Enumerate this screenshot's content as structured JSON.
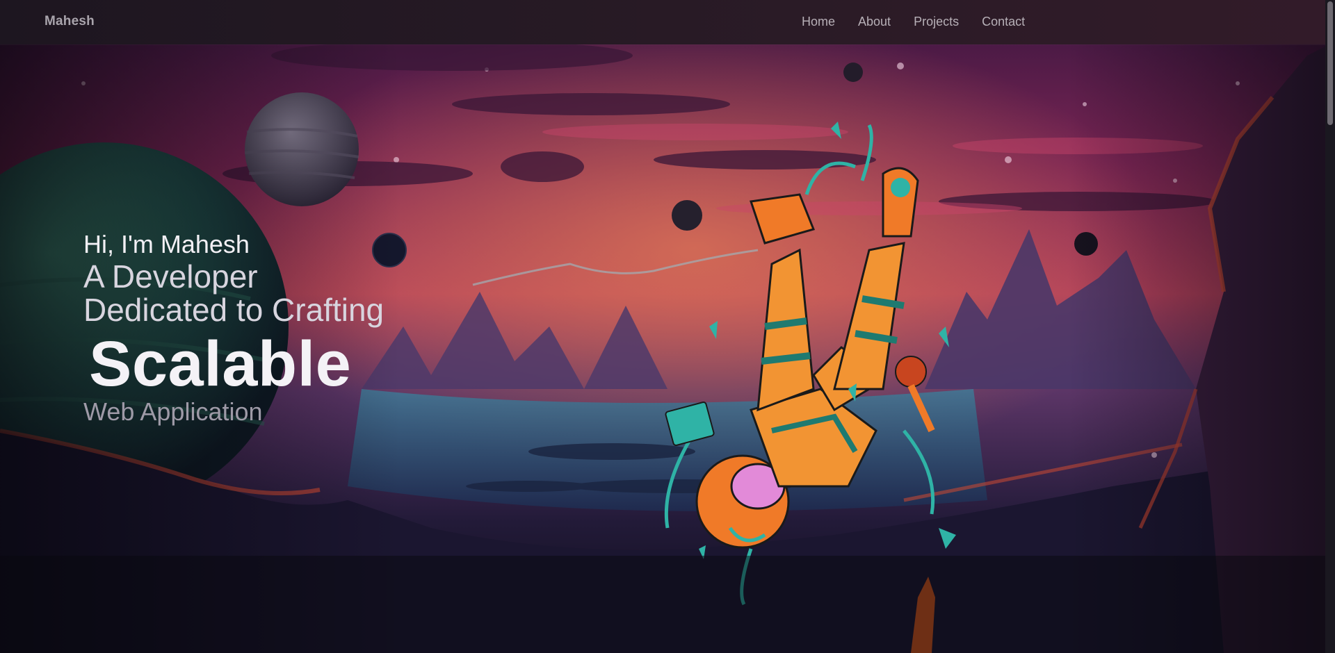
{
  "nav": {
    "brand": "Mahesh",
    "links": [
      {
        "label": "Home"
      },
      {
        "label": "About"
      },
      {
        "label": "Projects"
      },
      {
        "label": "Contact"
      }
    ]
  },
  "hero": {
    "greeting": "Hi, I'm Mahesh",
    "line2": "A Developer",
    "line3": "Dedicated to Crafting",
    "highlight": "Scalable",
    "line5": "Web Application"
  },
  "background": {
    "description_icon": "astronaut-illustration",
    "colors": {
      "sky_top": "#5b1f4d",
      "sky_mid": "#a8395e",
      "horizon": "#d9655a",
      "ground": "#1b1630",
      "astronaut_orange": "#f07a28",
      "astronaut_teal": "#2fb3a6"
    }
  }
}
